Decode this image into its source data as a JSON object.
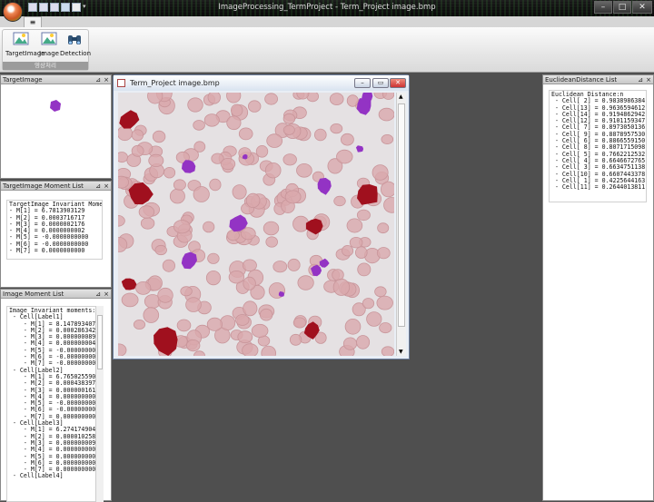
{
  "window": {
    "title": "ImageProcessing_TermProject - Term_Project image.bmp"
  },
  "ribbon": {
    "tab": "≡",
    "buttons": [
      {
        "label": "TargetImage"
      },
      {
        "label": "Image"
      },
      {
        "label": "Detection"
      }
    ],
    "group_label": "영상처리"
  },
  "panels": {
    "target_image": {
      "title": "TargetImage"
    },
    "target_moments": {
      "title": "TargetImage Moment List",
      "lines": [
        "TargetImage Invariant Moments:n",
        "- M[1] = 6.7813903129",
        "- M[2] = 0.0003716717",
        "- M[3] = 0.0000002176",
        "- M[4] = 0.0000000002",
        "- M[5] = -0.0000000000",
        "- M[6] = -0.0000000000",
        "- M[7] = 0.0000000000"
      ]
    },
    "image_moments": {
      "title": "Image Moment List",
      "lines": [
        "Image Invariant moments:n",
        " - Cell[Label1]",
        "    - M[1] = 8.1478934078",
        "    - M[2] = 0.0002863421",
        "    - M[3] = 0.0000000897",
        "    - M[4] = 0.0000000045",
        "    - M[5] = -0.0000000000",
        "    - M[6] = -0.0000000000",
        "    - M[7] = -0.0000000000",
        " - Cell[Label2]",
        "    - M[1] = 6.7650255908",
        "    - M[2] = 0.0004383972",
        "    - M[3] = 0.0000001612",
        "    - M[4] = 0.0000000001",
        "    - M[5] = -0.0000000000",
        "    - M[6] = -0.0000000000",
        "    - M[7] = 0.0000000000",
        " - Cell[Label3]",
        "    - M[1] = 6.2741749046",
        "    - M[2] = 0.0000102586",
        "    - M[3] = 0.0000000098",
        "    - M[4] = 0.0000000000",
        "    - M[5] = 0.0000000000",
        "    - M[6] = 0.0000000000",
        "    - M[7] = 0.0000000000",
        " - Cell[Label4]"
      ]
    },
    "euclidean": {
      "title": "EuclideanDistance List",
      "lines": [
        "Euclidean Distance:n",
        " - Cell[ 2] = 0.9838986384",
        " - Cell[13] = 0.9636594612",
        " - Cell[14] = 0.9194862942",
        " - Cell[12] = 0.9101159347",
        " - Cell[ 7] = 0.8973050136",
        " - Cell[ 9] = 0.8878957530",
        " - Cell[ 6] = 0.8866559150",
        " - Cell[ 8] = 0.8071715098",
        " - Cell[ 5] = 0.7662212532",
        " - Cell[ 4] = 0.6646672765",
        " - Cell[ 3] = 0.6634751138",
        " - Cell[10] = 0.6607443378",
        " - Cell[ 1] = 0.4225644163",
        " - Cell[11] = 0.2644013811"
      ]
    }
  },
  "image_window": {
    "title": "Term_Project image.bmp"
  },
  "colors": {
    "dark_cell": "#a0101e",
    "purple_cell": "#9333c4",
    "rbc": "#d9a9ad",
    "background": "#e5e1e3"
  }
}
